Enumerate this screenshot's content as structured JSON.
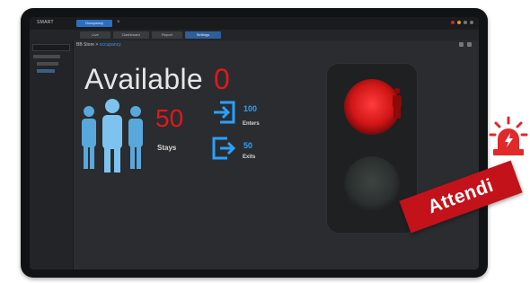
{
  "app": {
    "logo_text": "SMART",
    "active_tab": "Occupancy",
    "tab_close": "×"
  },
  "subbar": {
    "tabs": [
      "Live",
      "Dashboard",
      "Report",
      "Settings"
    ]
  },
  "breadcrumb": {
    "prefix": "BB Store",
    "separator": ">",
    "link": "occupancy"
  },
  "occupancy": {
    "available_label": "Available",
    "available_count": "0",
    "stays_count": "50",
    "stays_label": "Stays",
    "enters_count": "100",
    "enters_label": "Enters",
    "exits_count": "50",
    "exits_label": "Exits"
  },
  "status": {
    "banner": "Attendi",
    "light": "red"
  },
  "colors": {
    "accent_blue": "#2aa0ff",
    "alert_red": "#e0191c",
    "banner_red": "#c3121a"
  },
  "icons": [
    "people-icon",
    "enter-icon",
    "exit-icon",
    "person-icon",
    "alarm-icon"
  ]
}
